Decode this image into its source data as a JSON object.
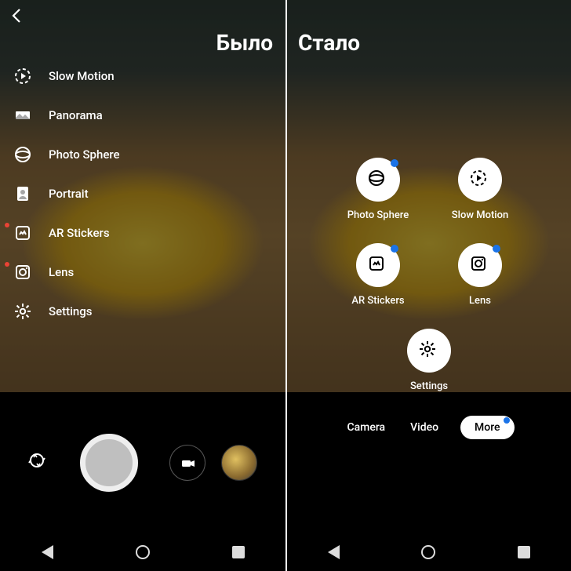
{
  "labels": {
    "before": "Было",
    "after": "Стало"
  },
  "left_menu": {
    "items": [
      {
        "label": "Slow Motion",
        "icon": "slowmo-icon",
        "new": false
      },
      {
        "label": "Panorama",
        "icon": "panorama-icon",
        "new": false
      },
      {
        "label": "Photo Sphere",
        "icon": "photosphere-icon",
        "new": false
      },
      {
        "label": "Portrait",
        "icon": "portrait-icon",
        "new": false
      },
      {
        "label": "AR Stickers",
        "icon": "arstickers-icon",
        "new": true
      },
      {
        "label": "Lens",
        "icon": "lens-icon",
        "new": true
      },
      {
        "label": "Settings",
        "icon": "settings-icon",
        "new": false
      }
    ]
  },
  "right_grid": {
    "items": [
      {
        "label": "Photo Sphere",
        "icon": "photosphere-icon",
        "new": true
      },
      {
        "label": "Slow Motion",
        "icon": "slowmo-icon",
        "new": false
      },
      {
        "label": "AR Stickers",
        "icon": "arstickers-icon",
        "new": true
      },
      {
        "label": "Lens",
        "icon": "lens-icon",
        "new": true
      },
      {
        "label": "Settings",
        "icon": "settings-icon",
        "new": false
      }
    ]
  },
  "right_modes": {
    "items": [
      {
        "label": "Camera",
        "active": false,
        "new": false
      },
      {
        "label": "Video",
        "active": false,
        "new": false
      },
      {
        "label": "More",
        "active": true,
        "new": true
      }
    ]
  },
  "colors": {
    "accent_blue": "#1a73e8",
    "accent_red": "#ea4335"
  }
}
